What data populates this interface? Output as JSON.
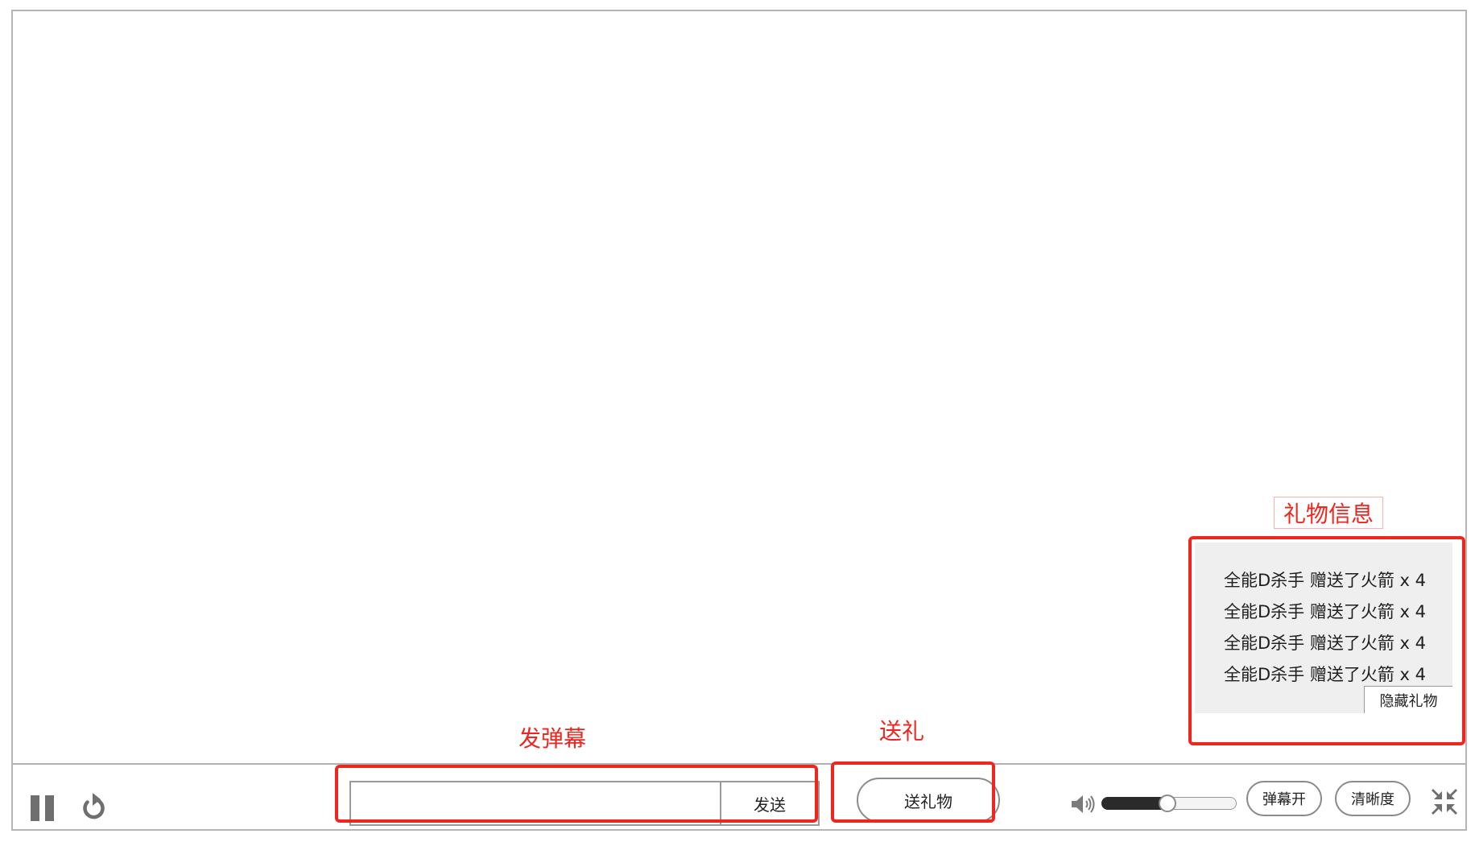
{
  "annotations": {
    "danmaku_label": "发弹幕",
    "gift_label": "送礼",
    "gift_info_label": "礼物信息",
    "color": "#f0251e"
  },
  "controls": {
    "pause_icon": "pause-icon",
    "reload_icon": "reload-icon",
    "danmaku_input": {
      "value": "",
      "placeholder": ""
    },
    "send_label": "发送",
    "gift_button_label": "送礼物",
    "volume_icon": "speaker-icon",
    "volume_level": 0.48,
    "danmaku_toggle_label": "弹幕开",
    "quality_label": "清晰度",
    "exit_fullscreen_icon": "exit-fullscreen-icon"
  },
  "gift_panel": {
    "entries": [
      "全能D杀手 赠送了火箭 x 4",
      "全能D杀手 赠送了火箭 x 4",
      "全能D杀手 赠送了火箭 x 4",
      "全能D杀手 赠送了火箭 x 4"
    ],
    "hide_label": "隐藏礼物"
  }
}
